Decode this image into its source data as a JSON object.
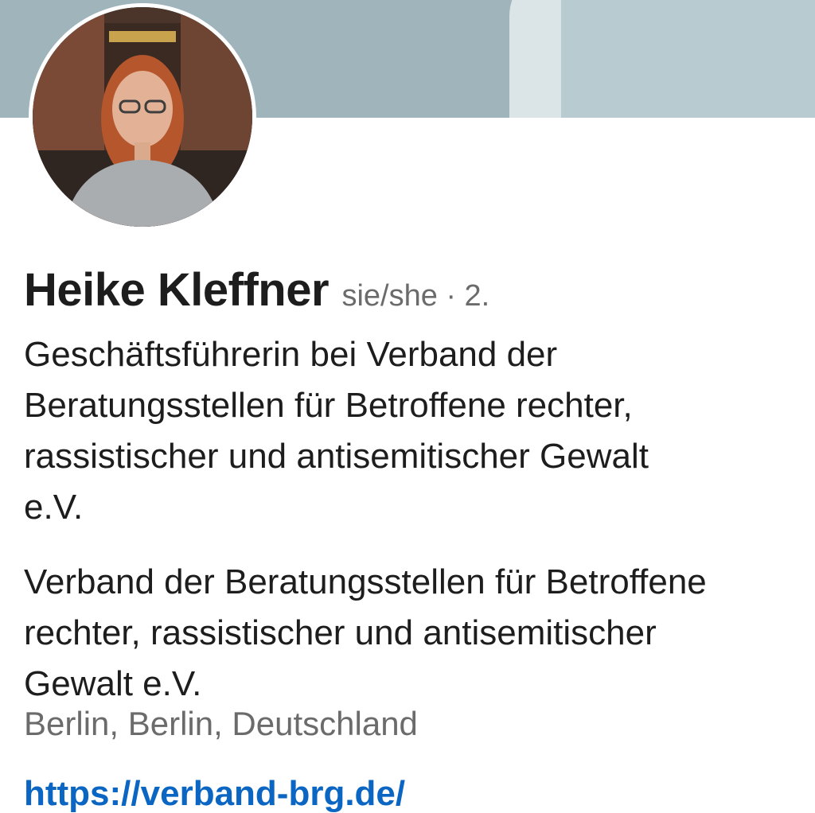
{
  "profile": {
    "name": "Heike Kleffner",
    "pronouns": "sie/she",
    "separator": "·",
    "connection_degree": "2.",
    "headline_lines": [
      "Geschäftsführerin bei Verband der",
      "Beratungsstellen für Betroffene rechter,",
      "rassistischer und antisemitischer Gewalt",
      "e.V."
    ],
    "company_lines": [
      "Verband der Beratungsstellen für Betroffene",
      "rechter, rassistischer und antisemitischer",
      "Gewalt e.V."
    ],
    "location": "Berlin, Berlin, Deutschland",
    "website": "https://verband-brg.de/"
  },
  "colors": {
    "banner": "#9fb4bb",
    "link": "#0a66c2",
    "secondary_text": "#6b6b6b",
    "primary_text": "#1d1d1d"
  },
  "icons": {
    "avatar": "profile-photo"
  }
}
